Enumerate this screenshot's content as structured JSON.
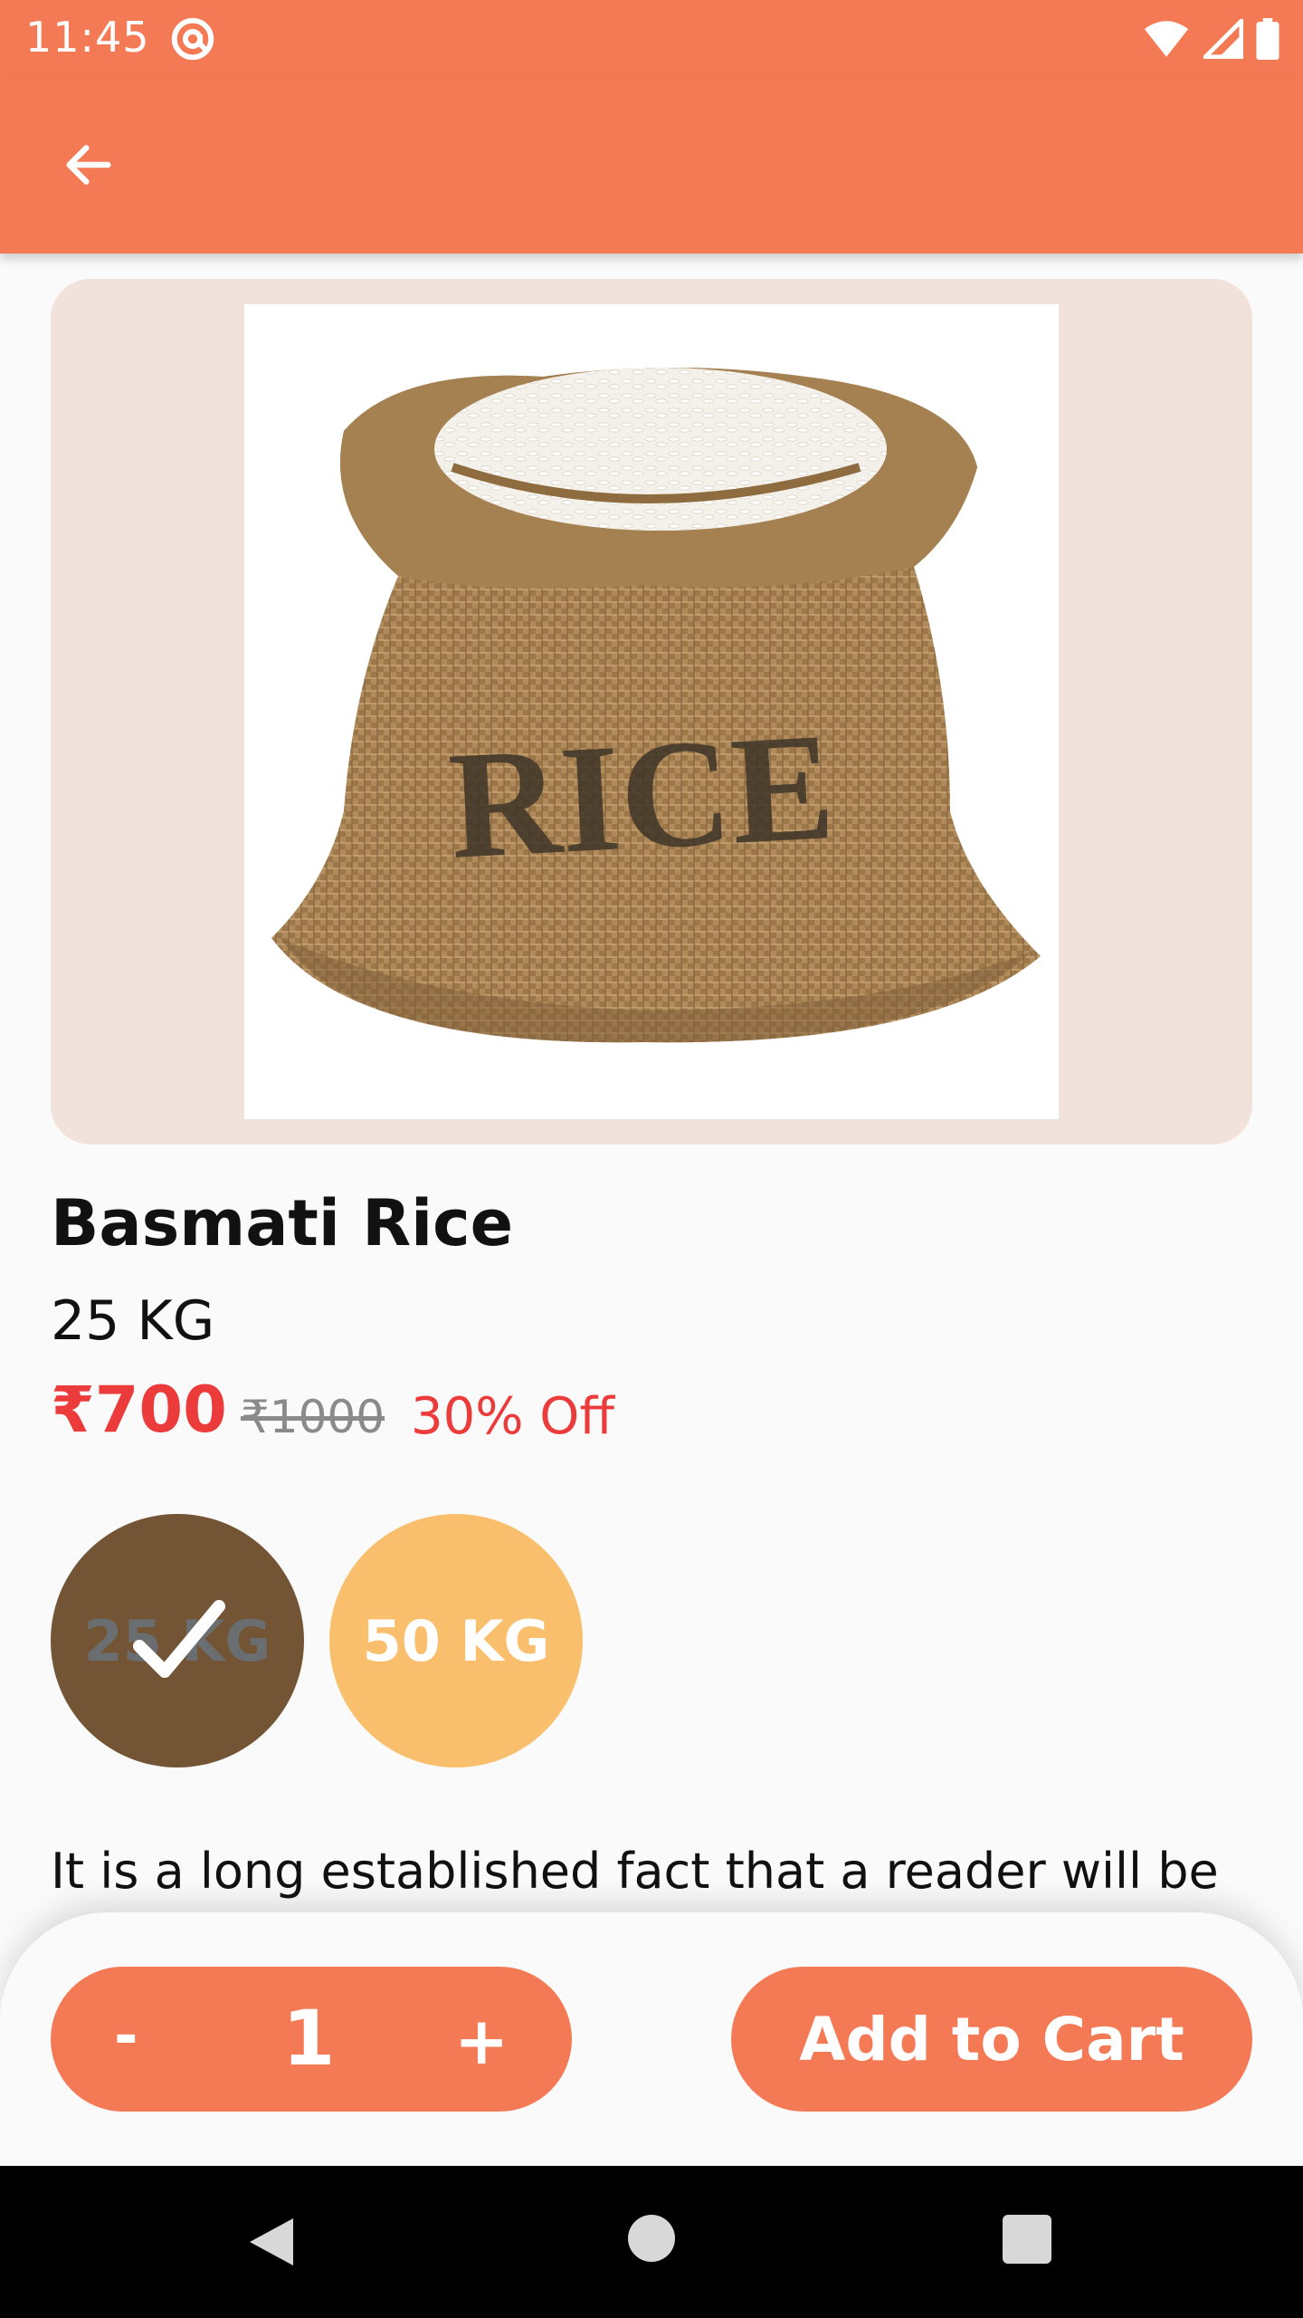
{
  "status_bar": {
    "time": "11:45"
  },
  "product": {
    "name": "Basmati Rice",
    "weight": "25 KG",
    "price": "₹700",
    "mrp": "₹1000",
    "discount": "30% Off",
    "bag_print": "RICE"
  },
  "weight_options": [
    {
      "label": "25 KG",
      "selected": true
    },
    {
      "label": "50 KG",
      "selected": false
    }
  ],
  "description": "It is a long established fact that a reader will be",
  "cart": {
    "minus_label": "-",
    "quantity": "1",
    "plus_label": "+",
    "add_to_cart_label": "Add to Cart"
  },
  "colors": {
    "accent": "#f47a56",
    "price_red": "#ec3b3b",
    "selected_option": "#735435",
    "unselected_option": "#f9bf6c",
    "image_card_bg": "#f2e2dc"
  },
  "icons": {
    "back": "arrow-left-icon",
    "status_app": "at-sign-icon",
    "wifi": "wifi-icon",
    "signal": "signal-icon",
    "battery": "battery-icon",
    "check": "check-icon"
  }
}
